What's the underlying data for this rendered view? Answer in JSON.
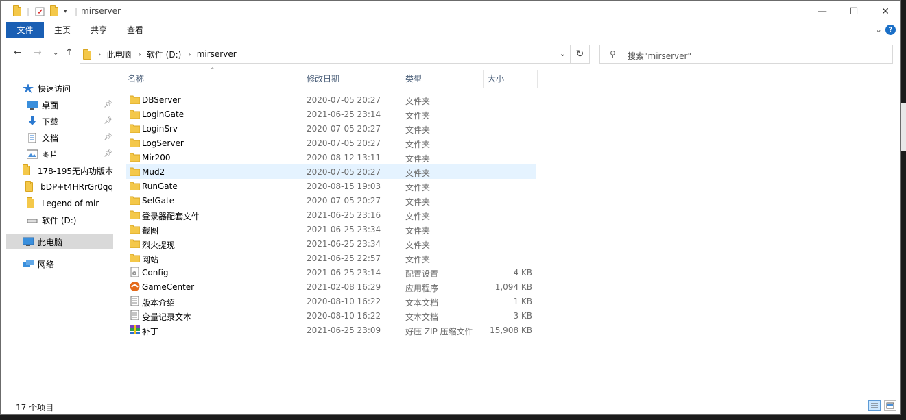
{
  "window": {
    "title": "mirserver",
    "minimize_glyph": "—",
    "maximize_glyph": "☐",
    "close_glyph": "✕"
  },
  "ribbon": {
    "tabs": [
      "文件",
      "主页",
      "共享",
      "查看"
    ],
    "help_glyph": "?",
    "collapse_glyph": "⌄"
  },
  "nav": {
    "back_glyph": "←",
    "forward_glyph": "→",
    "recent_glyph": "⌄",
    "up_glyph": "↑",
    "breadcrumb": [
      "此电脑",
      "软件 (D:)",
      "mirserver"
    ],
    "refresh_glyph": "↻",
    "search_placeholder": "搜索\"mirserver\""
  },
  "sidebar": {
    "items": [
      {
        "label": "快速访问",
        "icon": "star-icon",
        "pinned": false
      },
      {
        "label": "桌面",
        "icon": "desktop-icon",
        "pinned": true
      },
      {
        "label": "下载",
        "icon": "download-icon",
        "pinned": true
      },
      {
        "label": "文档",
        "icon": "document-icon",
        "pinned": true
      },
      {
        "label": "图片",
        "icon": "picture-icon",
        "pinned": true
      },
      {
        "label": "178-195无内功版本",
        "icon": "folder-icon",
        "pinned": false
      },
      {
        "label": "bDP+t4HRrGr0qq",
        "icon": "folder-icon",
        "pinned": false
      },
      {
        "label": "Legend of mir",
        "icon": "folder-icon",
        "pinned": false
      },
      {
        "label": "软件 (D:)",
        "icon": "drive-icon",
        "pinned": false
      },
      {
        "label": "此电脑",
        "icon": "computer-icon",
        "pinned": false
      },
      {
        "label": "网络",
        "icon": "network-icon",
        "pinned": false
      }
    ]
  },
  "columns": {
    "name": "名称",
    "date": "修改日期",
    "type": "类型",
    "size": "大小"
  },
  "files": [
    {
      "name": "DBServer",
      "date": "2020-07-05 20:27",
      "type": "文件夹",
      "size": "",
      "icon": "folder-icon"
    },
    {
      "name": "LoginGate",
      "date": "2021-06-25 23:14",
      "type": "文件夹",
      "size": "",
      "icon": "folder-icon"
    },
    {
      "name": "LoginSrv",
      "date": "2020-07-05 20:27",
      "type": "文件夹",
      "size": "",
      "icon": "folder-icon"
    },
    {
      "name": "LogServer",
      "date": "2020-07-05 20:27",
      "type": "文件夹",
      "size": "",
      "icon": "folder-icon"
    },
    {
      "name": "Mir200",
      "date": "2020-08-12 13:11",
      "type": "文件夹",
      "size": "",
      "icon": "folder-icon"
    },
    {
      "name": "Mud2",
      "date": "2020-07-05 20:27",
      "type": "文件夹",
      "size": "",
      "icon": "folder-icon"
    },
    {
      "name": "RunGate",
      "date": "2020-08-15 19:03",
      "type": "文件夹",
      "size": "",
      "icon": "folder-icon"
    },
    {
      "name": "SelGate",
      "date": "2020-07-05 20:27",
      "type": "文件夹",
      "size": "",
      "icon": "folder-icon"
    },
    {
      "name": "登录器配套文件",
      "date": "2021-06-25 23:16",
      "type": "文件夹",
      "size": "",
      "icon": "folder-icon"
    },
    {
      "name": "截图",
      "date": "2021-06-25 23:34",
      "type": "文件夹",
      "size": "",
      "icon": "folder-icon"
    },
    {
      "name": "烈火提现",
      "date": "2021-06-25 23:34",
      "type": "文件夹",
      "size": "",
      "icon": "folder-icon"
    },
    {
      "name": "网站",
      "date": "2021-06-25 22:57",
      "type": "文件夹",
      "size": "",
      "icon": "folder-icon"
    },
    {
      "name": "Config",
      "date": "2021-06-25 23:14",
      "type": "配置设置",
      "size": "4 KB",
      "icon": "config-file-icon"
    },
    {
      "name": "GameCenter",
      "date": "2021-02-08 16:29",
      "type": "应用程序",
      "size": "1,094 KB",
      "icon": "application-icon"
    },
    {
      "name": "版本介绍",
      "date": "2020-08-10 16:22",
      "type": "文本文档",
      "size": "1 KB",
      "icon": "text-file-icon"
    },
    {
      "name": "变量记录文本",
      "date": "2020-08-10 16:22",
      "type": "文本文档",
      "size": "3 KB",
      "icon": "text-file-icon"
    },
    {
      "name": "补丁",
      "date": "2021-06-25 23:09",
      "type": "好压 ZIP 压缩文件",
      "size": "15,908 KB",
      "icon": "zip-archive-icon"
    }
  ],
  "status": {
    "item_count": "17 个项目"
  },
  "colors": {
    "accent": "#1a5fb4",
    "selection": "#cce8ff",
    "row_hover": "#e5f3ff",
    "folder": "#f4c84a"
  }
}
